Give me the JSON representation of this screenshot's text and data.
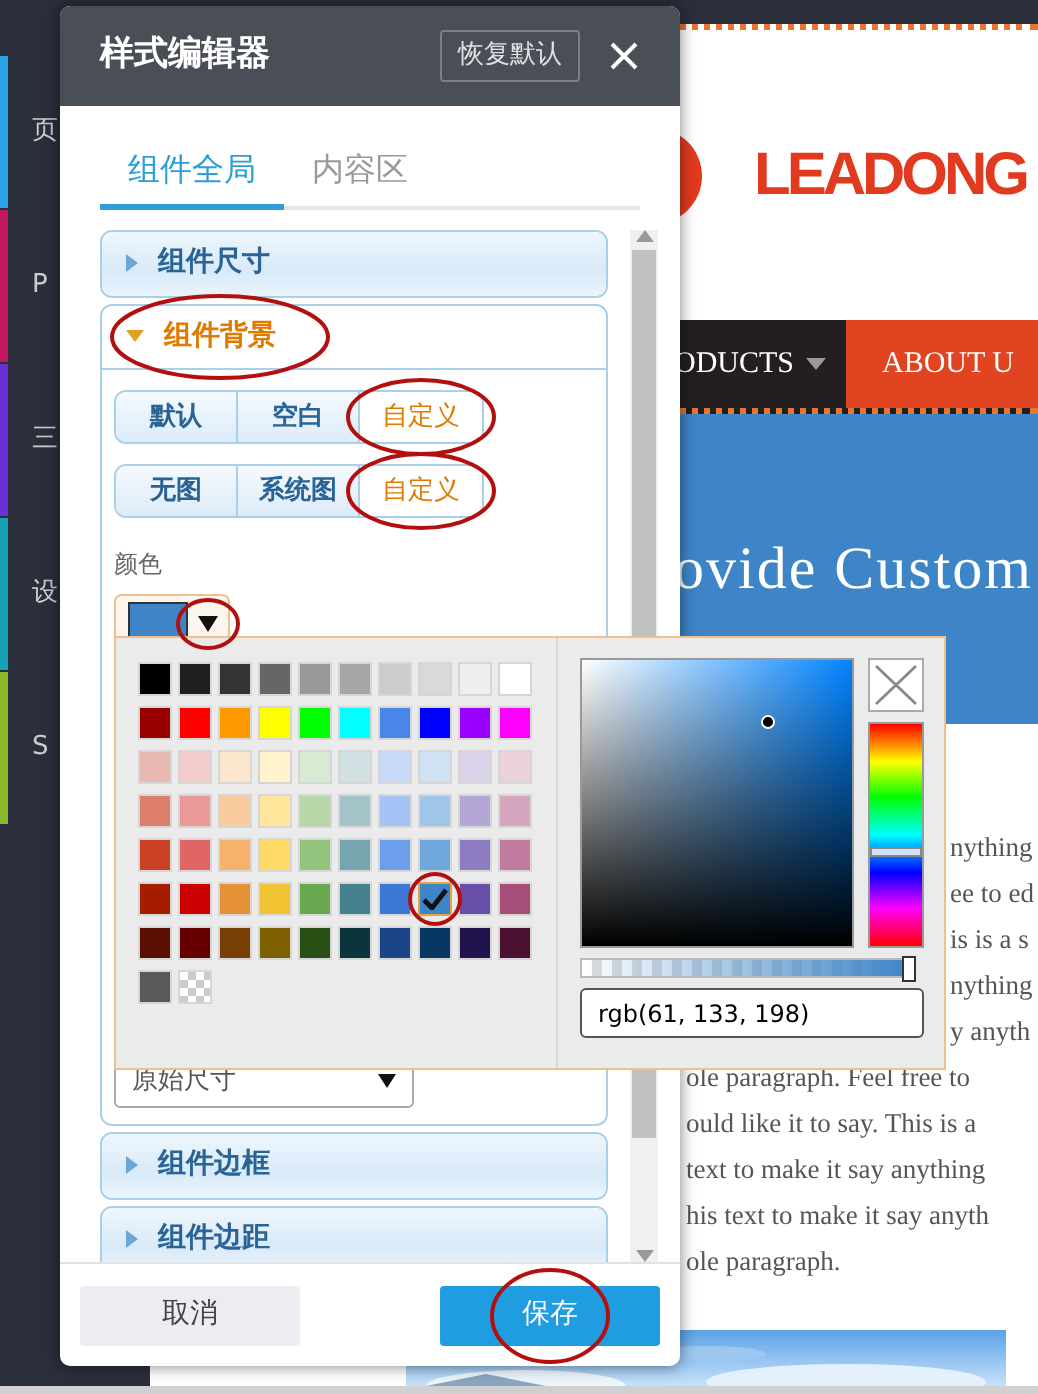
{
  "sidebar": {
    "items": [
      {
        "label": "页",
        "color": "#2aa3e6"
      },
      {
        "label": "P",
        "color": "#c2185b"
      },
      {
        "label": "三",
        "color": "#6b2fd6"
      },
      {
        "label": "设",
        "color": "#17a2b3"
      },
      {
        "label": "S",
        "color": "#8cb82b"
      }
    ]
  },
  "website": {
    "logo_text": "LEADONG",
    "nav": [
      {
        "label": "ODUCTS",
        "dropdown": true,
        "selected": false
      },
      {
        "label": "ABOUT U",
        "dropdown": false,
        "selected": true
      }
    ],
    "banner_text": "ovide Custom",
    "paragraph": {
      "beside_popover": [
        "nything",
        "ee to ed",
        "is is a s",
        "nything",
        "y anyth"
      ],
      "below_popover": [
        "ole paragraph. Feel free to",
        "ould like it to say.  This is a",
        "text to make it say anything",
        "his text to make it say anyth",
        "ole paragraph."
      ]
    }
  },
  "dialog": {
    "title": "样式编辑器",
    "reset_button": "恢复默认",
    "tabs": [
      {
        "label": "组件全局",
        "selected": true
      },
      {
        "label": "内容区",
        "selected": false
      }
    ],
    "panels": [
      {
        "title": "组件尺寸",
        "expanded": false,
        "circled": false
      },
      {
        "title": "组件背景",
        "expanded": true,
        "circled": true,
        "body": {
          "fill_options": [
            {
              "label": "默认",
              "selected": false,
              "circled": false
            },
            {
              "label": "空白",
              "selected": false,
              "circled": false
            },
            {
              "label": "自定义",
              "selected": true,
              "circled": true
            }
          ],
          "image_options": [
            {
              "label": "无图",
              "selected": false,
              "circled": false
            },
            {
              "label": "系统图",
              "selected": false,
              "circled": false
            },
            {
              "label": "自定义",
              "selected": true,
              "circled": true
            }
          ],
          "color_label": "颜色",
          "color_button": {
            "color": "#3d85c6",
            "arrow_circled": true
          },
          "size_select": {
            "value": "原始尺寸"
          }
        }
      },
      {
        "title": "组件边框",
        "expanded": false,
        "circled": false
      },
      {
        "title": "组件边距",
        "expanded": false,
        "circled": false
      }
    ],
    "footer": {
      "cancel": "取消",
      "save": {
        "label": "保存",
        "circled": true
      }
    }
  },
  "color_picker": {
    "swatches": [
      {
        "kind": "color",
        "color": "#000000",
        "selected": false,
        "circled": false
      },
      {
        "kind": "color",
        "color": "#1f1f1f",
        "selected": false,
        "circled": false
      },
      {
        "kind": "color",
        "color": "#333333",
        "selected": false,
        "circled": false
      },
      {
        "kind": "color",
        "color": "#666666",
        "selected": false,
        "circled": false
      },
      {
        "kind": "color",
        "color": "#999999",
        "selected": false,
        "circled": false
      },
      {
        "kind": "color",
        "color": "#a6a6a6",
        "selected": false,
        "circled": false
      },
      {
        "kind": "color",
        "color": "#cccccc",
        "selected": false,
        "circled": false
      },
      {
        "kind": "color",
        "color": "#d9d9d9",
        "selected": false,
        "circled": false
      },
      {
        "kind": "color",
        "color": "#efefef",
        "selected": false,
        "circled": false
      },
      {
        "kind": "color",
        "color": "#ffffff",
        "selected": false,
        "circled": false
      },
      {
        "kind": "color",
        "color": "#980000",
        "selected": false,
        "circled": false
      },
      {
        "kind": "color",
        "color": "#ff0000",
        "selected": false,
        "circled": false
      },
      {
        "kind": "color",
        "color": "#ff9900",
        "selected": false,
        "circled": false
      },
      {
        "kind": "color",
        "color": "#ffff00",
        "selected": false,
        "circled": false
      },
      {
        "kind": "color",
        "color": "#00ff00",
        "selected": false,
        "circled": false
      },
      {
        "kind": "color",
        "color": "#00ffff",
        "selected": false,
        "circled": false
      },
      {
        "kind": "color",
        "color": "#4a86e8",
        "selected": false,
        "circled": false
      },
      {
        "kind": "color",
        "color": "#0000ff",
        "selected": false,
        "circled": false
      },
      {
        "kind": "color",
        "color": "#9900ff",
        "selected": false,
        "circled": false
      },
      {
        "kind": "color",
        "color": "#ff00ff",
        "selected": false,
        "circled": false
      },
      {
        "kind": "color",
        "color": "#e6b8af",
        "selected": false,
        "circled": false
      },
      {
        "kind": "color",
        "color": "#f4cccc",
        "selected": false,
        "circled": false
      },
      {
        "kind": "color",
        "color": "#fce5cd",
        "selected": false,
        "circled": false
      },
      {
        "kind": "color",
        "color": "#fff2cc",
        "selected": false,
        "circled": false
      },
      {
        "kind": "color",
        "color": "#d9ead3",
        "selected": false,
        "circled": false
      },
      {
        "kind": "color",
        "color": "#d0e0e3",
        "selected": false,
        "circled": false
      },
      {
        "kind": "color",
        "color": "#c9daf8",
        "selected": false,
        "circled": false
      },
      {
        "kind": "color",
        "color": "#cfe2f3",
        "selected": false,
        "circled": false
      },
      {
        "kind": "color",
        "color": "#d9d2e9",
        "selected": false,
        "circled": false
      },
      {
        "kind": "color",
        "color": "#ead1dc",
        "selected": false,
        "circled": false
      },
      {
        "kind": "color",
        "color": "#dd7e6b",
        "selected": false,
        "circled": false
      },
      {
        "kind": "color",
        "color": "#ea9999",
        "selected": false,
        "circled": false
      },
      {
        "kind": "color",
        "color": "#f9cb9c",
        "selected": false,
        "circled": false
      },
      {
        "kind": "color",
        "color": "#ffe599",
        "selected": false,
        "circled": false
      },
      {
        "kind": "color",
        "color": "#b6d7a8",
        "selected": false,
        "circled": false
      },
      {
        "kind": "color",
        "color": "#a2c4c9",
        "selected": false,
        "circled": false
      },
      {
        "kind": "color",
        "color": "#a4c2f4",
        "selected": false,
        "circled": false
      },
      {
        "kind": "color",
        "color": "#9fc5e8",
        "selected": false,
        "circled": false
      },
      {
        "kind": "color",
        "color": "#b4a7d6",
        "selected": false,
        "circled": false
      },
      {
        "kind": "color",
        "color": "#d5a6bd",
        "selected": false,
        "circled": false
      },
      {
        "kind": "color",
        "color": "#cc4125",
        "selected": false,
        "circled": false
      },
      {
        "kind": "color",
        "color": "#e06666",
        "selected": false,
        "circled": false
      },
      {
        "kind": "color",
        "color": "#f6b26b",
        "selected": false,
        "circled": false
      },
      {
        "kind": "color",
        "color": "#ffd966",
        "selected": false,
        "circled": false
      },
      {
        "kind": "color",
        "color": "#93c47d",
        "selected": false,
        "circled": false
      },
      {
        "kind": "color",
        "color": "#76a5af",
        "selected": false,
        "circled": false
      },
      {
        "kind": "color",
        "color": "#6d9eeb",
        "selected": false,
        "circled": false
      },
      {
        "kind": "color",
        "color": "#6fa8dc",
        "selected": false,
        "circled": false
      },
      {
        "kind": "color",
        "color": "#8e7cc3",
        "selected": false,
        "circled": false
      },
      {
        "kind": "color",
        "color": "#c27ba0",
        "selected": false,
        "circled": false
      },
      {
        "kind": "color",
        "color": "#a61c00",
        "selected": false,
        "circled": false
      },
      {
        "kind": "color",
        "color": "#cc0000",
        "selected": false,
        "circled": false
      },
      {
        "kind": "color",
        "color": "#e69138",
        "selected": false,
        "circled": false
      },
      {
        "kind": "color",
        "color": "#f1c232",
        "selected": false,
        "circled": false
      },
      {
        "kind": "color",
        "color": "#6aa84f",
        "selected": false,
        "circled": false
      },
      {
        "kind": "color",
        "color": "#45818e",
        "selected": false,
        "circled": false
      },
      {
        "kind": "color",
        "color": "#3c78d8",
        "selected": false,
        "circled": false
      },
      {
        "kind": "color",
        "color": "#3d85c6",
        "selected": true,
        "circled": true
      },
      {
        "kind": "color",
        "color": "#674ea7",
        "selected": false,
        "circled": false
      },
      {
        "kind": "color",
        "color": "#a64d79",
        "selected": false,
        "circled": false
      },
      {
        "kind": "color",
        "color": "#5b0f00",
        "selected": false,
        "circled": false
      },
      {
        "kind": "color",
        "color": "#660000",
        "selected": false,
        "circled": false
      },
      {
        "kind": "color",
        "color": "#783f04",
        "selected": false,
        "circled": false
      },
      {
        "kind": "color",
        "color": "#7f6000",
        "selected": false,
        "circled": false
      },
      {
        "kind": "color",
        "color": "#274e13",
        "selected": false,
        "circled": false
      },
      {
        "kind": "color",
        "color": "#0c343d",
        "selected": false,
        "circled": false
      },
      {
        "kind": "color",
        "color": "#1c4587",
        "selected": false,
        "circled": false
      },
      {
        "kind": "color",
        "color": "#073763",
        "selected": false,
        "circled": false
      },
      {
        "kind": "color",
        "color": "#20124d",
        "selected": false,
        "circled": false
      },
      {
        "kind": "color",
        "color": "#4c1130",
        "selected": false,
        "circled": false
      },
      {
        "kind": "color",
        "color": "#595959",
        "selected": false,
        "circled": false
      },
      {
        "kind": "transparent",
        "selected": false,
        "circled": false
      }
    ],
    "alpha": {
      "level": 1
    },
    "value": "rgb(61, 133, 198)"
  }
}
